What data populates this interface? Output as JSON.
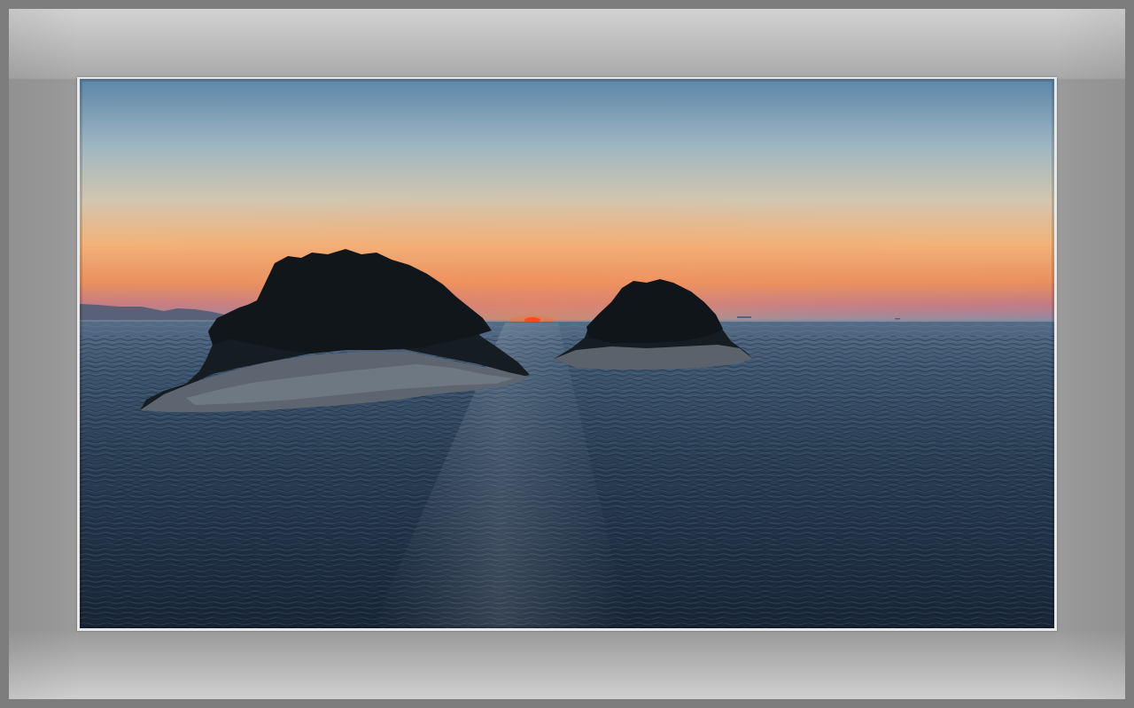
{
  "scene": {
    "subject": "sunset-over-sea-with-two-islands",
    "colors": {
      "frame_outer": "#7d7d7d",
      "mat_light": "#d2d2d2",
      "mat_mid": "#9a9a9a",
      "photo_border": "#e8e8e8",
      "sky_top": "#5f88a8",
      "sky_middle": "#b9c6c6",
      "sky_glow": "#f0a060",
      "horizon_pink": "#c07a84",
      "sun": "#ff3a1a",
      "sea_near": "#1c2c3e",
      "sea_far": "#4a6480",
      "island_dark": "#141a1e",
      "rock": "#6c7680"
    }
  }
}
